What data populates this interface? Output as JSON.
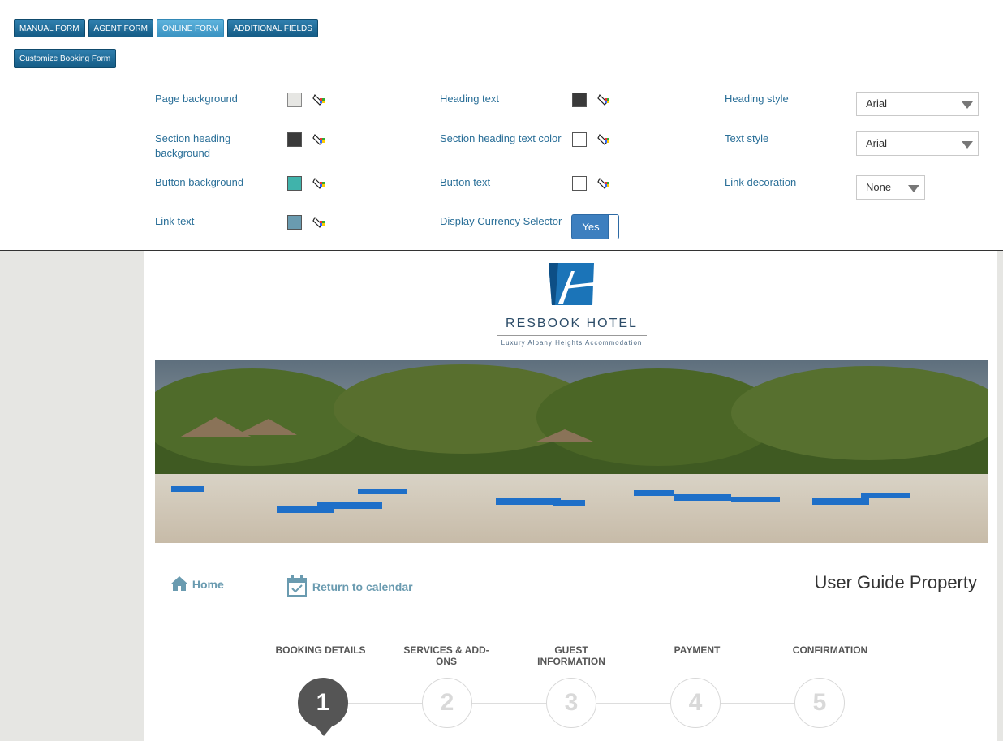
{
  "tabs": [
    {
      "label": "MANUAL FORM",
      "active": false
    },
    {
      "label": "AGENT FORM",
      "active": false
    },
    {
      "label": "ONLINE FORM",
      "active": true
    },
    {
      "label": "ADDITIONAL FIELDS",
      "active": false
    }
  ],
  "customize_button": "Customize Booking Form",
  "settings": {
    "page_background": {
      "label": "Page background",
      "color": "#e6e6e3"
    },
    "section_heading_background": {
      "label": "Section heading background",
      "color": "#3a3a3a"
    },
    "button_background": {
      "label": "Button background",
      "color": "#40b3ab"
    },
    "link_text": {
      "label": "Link text",
      "color": "#6a9bb0"
    },
    "heading_text": {
      "label": "Heading text",
      "color": "#3a3a3a"
    },
    "section_heading_text_color": {
      "label": "Section heading text color",
      "color": "#ffffff"
    },
    "button_text": {
      "label": "Button text",
      "color": "#ffffff"
    },
    "display_currency_selector": {
      "label": "Display Currency Selector",
      "value": "Yes"
    },
    "heading_style": {
      "label": "Heading style",
      "value": "Arial"
    },
    "text_style": {
      "label": "Text style",
      "value": "Arial"
    },
    "link_decoration": {
      "label": "Link decoration",
      "value": "None"
    }
  },
  "preview": {
    "brand_name": "RESBOOK HOTEL",
    "tagline": "Luxury Albany Heights Accommodation",
    "nav_home": "Home",
    "nav_calendar": "Return to calendar",
    "property_title": "User Guide Property",
    "steps": [
      {
        "label": "BOOKING DETAILS",
        "number": "1",
        "active": true
      },
      {
        "label": "SERVICES & ADD-ONS",
        "number": "2",
        "active": false
      },
      {
        "label": "GUEST INFORMATION",
        "number": "3",
        "active": false
      },
      {
        "label": "PAYMENT",
        "number": "4",
        "active": false
      },
      {
        "label": "CONFIRMATION",
        "number": "5",
        "active": false
      }
    ]
  },
  "colors": {
    "link": "#2a6f98",
    "accent": "#3d7fbf",
    "logo_blue": "#1b74b8"
  }
}
